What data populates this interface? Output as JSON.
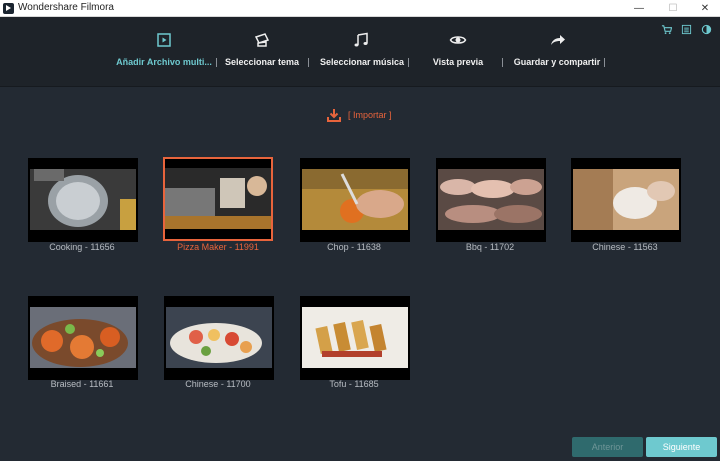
{
  "window": {
    "title": "Wondershare Filmora",
    "minimize": "—",
    "maximize": "☐",
    "close": "✕"
  },
  "header": {
    "icons": [
      "cart-icon",
      "menu-icon",
      "theme-icon"
    ],
    "steps": [
      {
        "id": "add-media",
        "label": "Añadir Archivo multi...",
        "icon": "media-icon",
        "active": true
      },
      {
        "id": "select-theme",
        "label": "Seleccionar tema",
        "icon": "theme-card-icon",
        "active": false
      },
      {
        "id": "select-music",
        "label": "Seleccionar música",
        "icon": "music-note-icon",
        "active": false
      },
      {
        "id": "preview",
        "label": "Vista previa",
        "icon": "eye-icon",
        "active": false
      },
      {
        "id": "save-share",
        "label": "Guardar y compartir",
        "icon": "share-arrow-icon",
        "active": false
      }
    ]
  },
  "import": {
    "label": "[ Importar ]",
    "icon": "download-icon"
  },
  "media": [
    {
      "label": "Cooking - 11656",
      "selected": false
    },
    {
      "label": "Pizza Maker - 11991",
      "selected": true
    },
    {
      "label": "Chop - 11638",
      "selected": false
    },
    {
      "label": "Bbq - 11702",
      "selected": false
    },
    {
      "label": "Chinese - 11563",
      "selected": false
    },
    {
      "label": "Braised - 11661",
      "selected": false
    },
    {
      "label": "Chinese - 11700",
      "selected": false
    },
    {
      "label": "Tofu - 11685",
      "selected": false
    }
  ],
  "footer": {
    "prev_label": "Anterior",
    "next_label": "Siguiente",
    "prev_enabled": false
  },
  "colors": {
    "accent": "#6ec9cf",
    "selected": "#e8643c",
    "background": "#232a33",
    "header": "#1e2329"
  }
}
